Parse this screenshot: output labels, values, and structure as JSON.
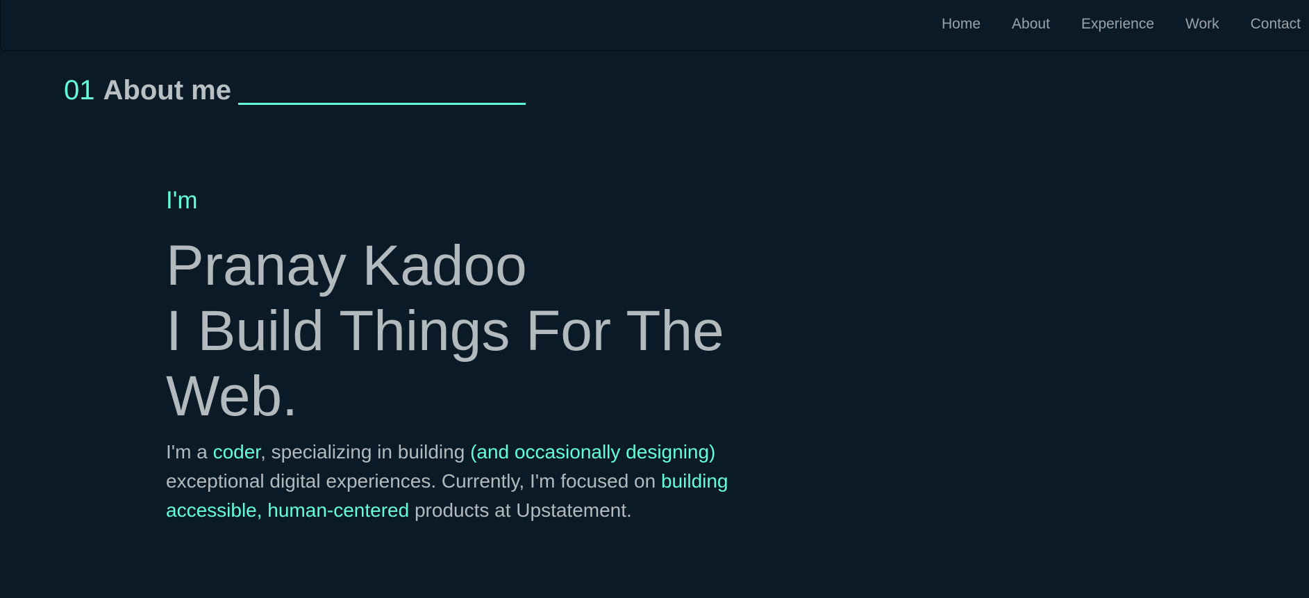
{
  "nav": {
    "items": [
      "Home",
      "About",
      "Experience",
      "Work",
      "Contact"
    ]
  },
  "section": {
    "number": "01",
    "title": "About me"
  },
  "hero": {
    "intro": "I'm",
    "name": "Pranay Kadoo",
    "tagline": "I Build Things For The Web.",
    "bio": {
      "p1": "I'm a ",
      "h1": "coder",
      "p2": ", specializing in building ",
      "h2": "(and occasionally designing)",
      "p3": " exceptional digital experiences. Currently, I'm focused on ",
      "h3": "building accessible, human-centered",
      "p4": " products at Upstatement."
    }
  },
  "colors": {
    "background": "#0a1a27",
    "accent": "#64ffda",
    "text": "#b3babd",
    "nav_text": "#9ba3a8"
  }
}
